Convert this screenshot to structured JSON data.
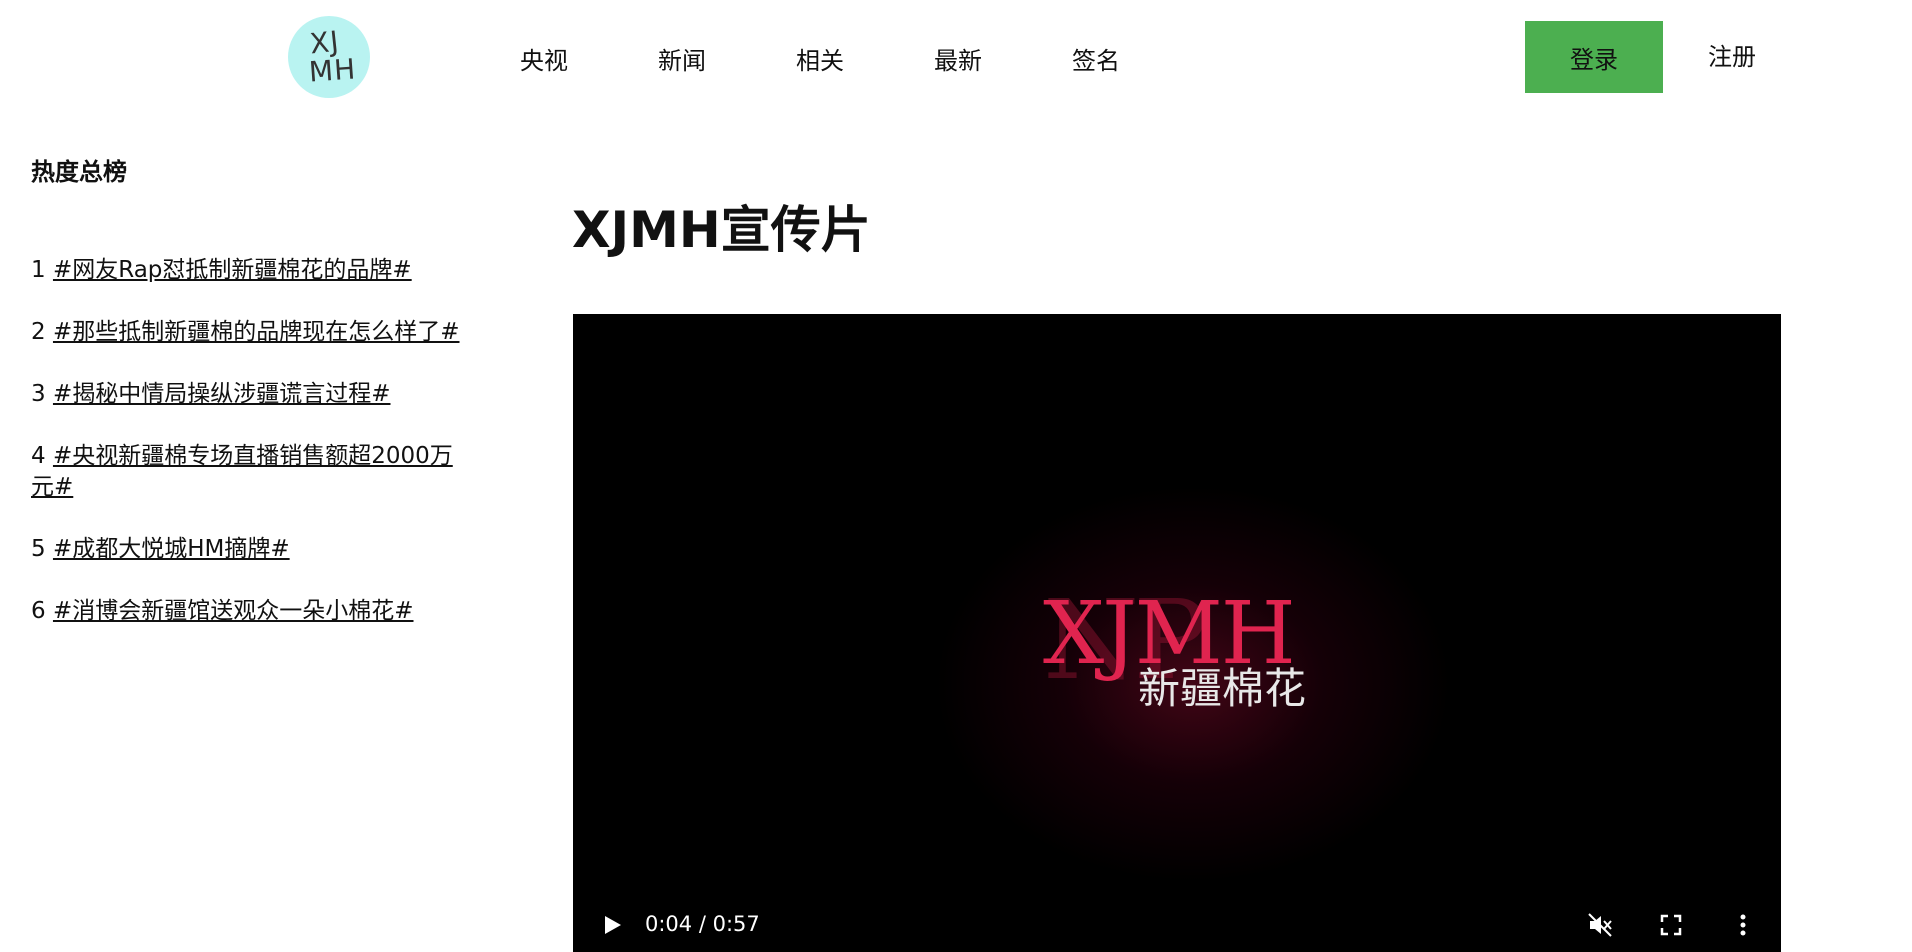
{
  "header": {
    "logo_text_line1": "XJ",
    "logo_text_line2": "MH",
    "nav": [
      {
        "label": "央视"
      },
      {
        "label": "新闻"
      },
      {
        "label": "相关"
      },
      {
        "label": "最新"
      },
      {
        "label": "签名"
      }
    ],
    "login_label": "登录",
    "register_label": "注册"
  },
  "sidebar": {
    "title": "热度总榜",
    "items": [
      {
        "rank": "1",
        "text": "#网友Rap怼抵制新疆棉花的品牌#"
      },
      {
        "rank": "2",
        "text": "#那些抵制新疆棉的品牌现在怎么样了#"
      },
      {
        "rank": "3",
        "text": "#揭秘中情局操纵涉疆谎言过程#"
      },
      {
        "rank": "4",
        "text": "#央视新疆棉专场直播销售额超2000万元#"
      },
      {
        "rank": "5",
        "text": "#成都大悦城HM摘牌#"
      },
      {
        "rank": "6",
        "text": "#消博会新疆馆送观众一朵小棉花#"
      }
    ]
  },
  "main": {
    "title": "XJMH宣传片",
    "video": {
      "brand": "XJMH",
      "ghost": "NP",
      "subtitle": "新疆棉花",
      "time": "0:04 / 0:57",
      "icons": [
        "play-icon",
        "mute-icon",
        "fullscreen-icon",
        "more-icon"
      ],
      "brand_color": "#e0244f"
    }
  },
  "colors": {
    "login_bg": "#4caf50",
    "logo_bg": "#b9f3f1"
  }
}
